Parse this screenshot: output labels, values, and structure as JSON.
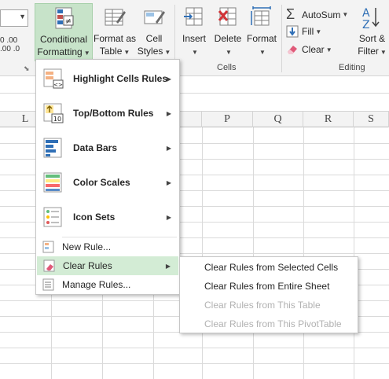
{
  "ribbon": {
    "conditional_formatting": {
      "line1": "Conditional",
      "line2": "Formatting",
      "icon": "conditional-formatting-icon"
    },
    "format_as_table": {
      "line1": "Format as",
      "line2": "Table",
      "icon": "table-format-icon"
    },
    "cell_styles": {
      "line1": "Cell",
      "line2": "Styles",
      "icon": "cell-styles-icon"
    },
    "insert": {
      "label": "Insert",
      "icon": "insert-cells-icon"
    },
    "delete": {
      "label": "Delete",
      "icon": "delete-cells-icon"
    },
    "format": {
      "label": "Format",
      "icon": "format-cells-icon"
    },
    "autosum": {
      "label": "AutoSum",
      "symbol": "Σ"
    },
    "fill": {
      "label": "Fill"
    },
    "clear": {
      "label": "Clear"
    },
    "sort_filter": {
      "line1": "Sort &",
      "line2": "Filter"
    },
    "groups": {
      "cells": "Cells",
      "editing": "Editing"
    },
    "left_partial": {
      "num_a": "0",
      "num_b": ".00",
      "num_c": ".00",
      "num_d": ".0"
    }
  },
  "columns": [
    "L",
    "P",
    "Q",
    "R",
    "S"
  ],
  "menu": {
    "items": [
      {
        "label": "Highlight Cells Rules",
        "accel": "H",
        "icon": "highlight-cells-icon"
      },
      {
        "label": "Top/Bottom Rules",
        "accel": "T",
        "icon": "top-bottom-icon"
      },
      {
        "label": "Data Bars",
        "accel": "D",
        "icon": "data-bars-icon"
      },
      {
        "label": "Color Scales",
        "accel": "S",
        "icon": "color-scales-icon"
      },
      {
        "label": "Icon Sets",
        "accel": "I",
        "icon": "icon-sets-icon"
      }
    ],
    "new_rule": "New Rule...",
    "clear_rules": "Clear Rules",
    "manage_rules": "Manage Rules..."
  },
  "submenu": {
    "items": [
      {
        "label": "Clear Rules from Selected Cells",
        "enabled": true
      },
      {
        "label": "Clear Rules from Entire Sheet",
        "enabled": true
      },
      {
        "label": "Clear Rules from This Table",
        "enabled": false
      },
      {
        "label": "Clear Rules from This PivotTable",
        "enabled": false
      }
    ]
  },
  "colors": {
    "accent_green": "#c7e3c9",
    "highlight_green": "#d3ecd5",
    "disabled_text": "#b1b1b1"
  }
}
